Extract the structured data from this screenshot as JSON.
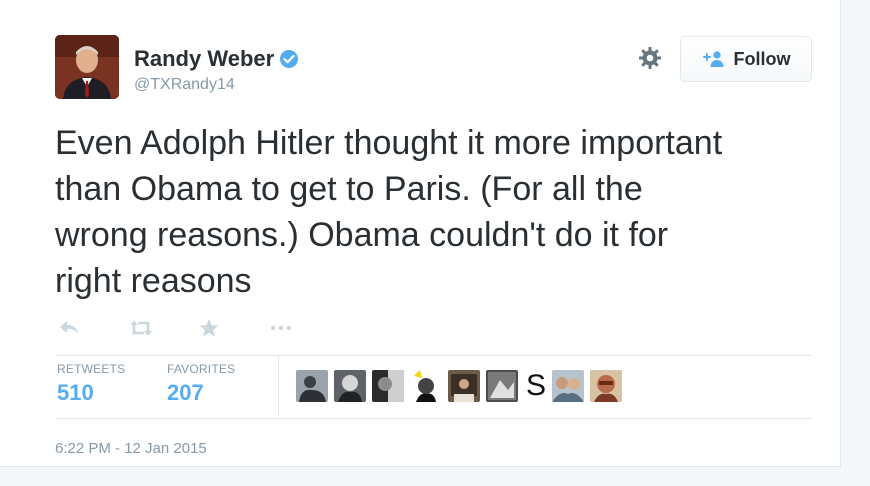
{
  "user": {
    "name": "Randy Weber",
    "handle": "@TXRandy14",
    "verified": true
  },
  "header": {
    "settings_icon": "gear-icon",
    "follow_label": "Follow"
  },
  "tweet": {
    "text_lines": [
      "Even Adolph Hitler thought it more important",
      "than Obama to get to Paris. (For all the",
      "wrong reasons.) Obama couldn't do it for",
      "right reasons"
    ]
  },
  "actions": [
    "reply-icon",
    "retweet-icon",
    "favorite-icon",
    "more-icon"
  ],
  "stats": {
    "retweets_label": "RETWEETS",
    "retweets_count": "510",
    "favorites_label": "FAVORITES",
    "favorites_count": "207"
  },
  "favoriters": {
    "letter_avatar": "S"
  },
  "timestamp": "6:22 PM - 12 Jan 2015",
  "colors": {
    "accent": "#55acee",
    "text": "#292f33",
    "muted": "#8899a6",
    "border": "#e1e8ed"
  }
}
